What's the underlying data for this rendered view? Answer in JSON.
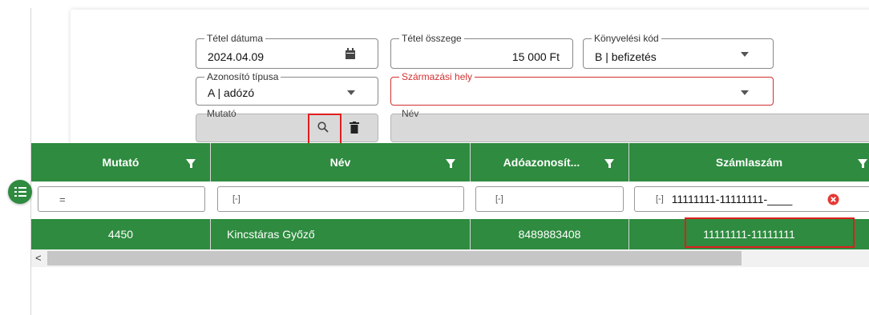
{
  "form": {
    "tetel_datuma": {
      "label": "Tétel dátuma",
      "value": "2024.04.09",
      "icon": "calendar-icon"
    },
    "tetel_osszege": {
      "label": "Tétel összege",
      "value": "15 000 Ft"
    },
    "konyvelesi_kod": {
      "label": "Könyvelési kód",
      "value": "B | befizetés"
    },
    "azonosito_tipusa": {
      "label": "Azonosító típusa",
      "value": "A | adózó"
    },
    "szarmazasi_hely": {
      "label": "Származási hely",
      "value": ""
    },
    "mutato": {
      "label": "Mutató",
      "value": ""
    },
    "nev": {
      "label": "Név",
      "value": ""
    }
  },
  "grid": {
    "columns": [
      "Mutató",
      "Név",
      "Adóazonosít...",
      "Számlaszám"
    ],
    "filters": {
      "mutato": "=",
      "nev": "[-]",
      "adoazonosito": "[-]",
      "szamlaszam_prefix": "[-]",
      "szamlaszam_value": "11111111-11111111-____"
    },
    "rows": [
      {
        "mutato": "4450",
        "nev": "Kincstáras Győző",
        "adoazonosito": "8489883408",
        "szamlaszam": "11111111-11111111"
      }
    ],
    "scroll_left": "<"
  },
  "colors": {
    "header_green": "#2e8b3f",
    "error_red": "#d32f2f",
    "highlight_red": "#e01e1e"
  }
}
